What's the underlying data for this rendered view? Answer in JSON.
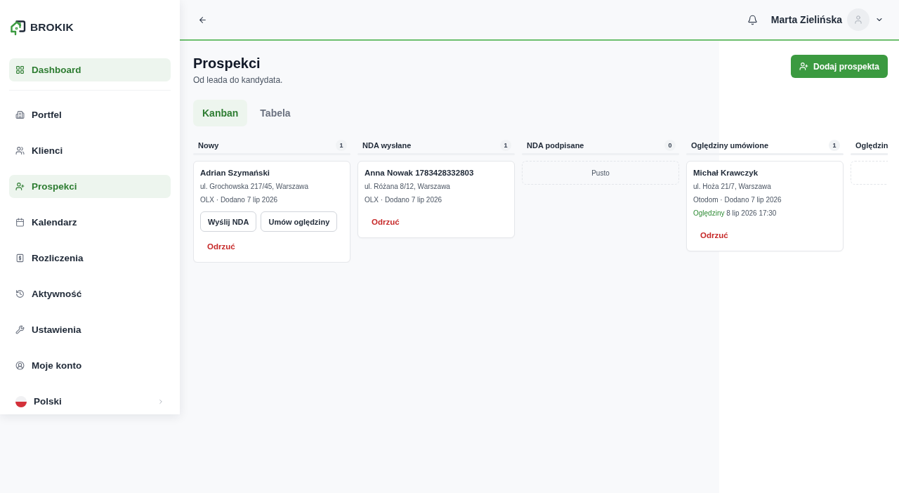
{
  "sidebar": {
    "logo": "BROKIK",
    "top_items": [
      {
        "label": "Dashboard",
        "selected": true
      }
    ],
    "items": [
      {
        "label": "Portfel",
        "selected": false
      },
      {
        "label": "Klienci",
        "selected": false
      },
      {
        "label": "Prospekci",
        "selected": true
      },
      {
        "label": "Kalendarz",
        "selected": false
      },
      {
        "label": "Rozliczenia",
        "selected": false
      },
      {
        "label": "Aktywność",
        "selected": false
      },
      {
        "label": "Ustawienia",
        "selected": false
      },
      {
        "label": "Moje konto",
        "selected": false
      }
    ],
    "language": {
      "label": "Polski"
    }
  },
  "header": {
    "user_name": "Marta Zielińska"
  },
  "page": {
    "title": "Prospekci",
    "subtitle": "Od leada do kandydata.",
    "primary_button": "Dodaj prospekta"
  },
  "tabs": [
    {
      "label": "Kanban",
      "selected": true
    },
    {
      "label": "Tabela",
      "selected": false
    }
  ],
  "columns": [
    {
      "title": "Nowy",
      "count": "1",
      "cards": [
        {
          "name": "Adrian Szymański",
          "address": "ul. Grochowska 217/45, Warszawa",
          "meta": "OLX · Dodano 7 lip 2026",
          "actions": [
            {
              "label": "Wyślij NDA",
              "kind": "outline"
            },
            {
              "label": "Umów oględziny",
              "kind": "outline"
            },
            {
              "label": "Odrzuć",
              "kind": "danger"
            }
          ]
        }
      ]
    },
    {
      "title": "NDA wysłane",
      "count": "1",
      "cards": [
        {
          "name": "Anna Nowak 1783428332803",
          "address": "ul. Różana 8/12, Warszawa",
          "meta": "OLX · Dodano 7 lip 2026",
          "actions": [
            {
              "label": "Odrzuć",
              "kind": "danger"
            }
          ]
        }
      ]
    },
    {
      "title": "NDA podpisane",
      "count": "0",
      "empty_label": "Pusto"
    },
    {
      "title": "Oględziny umówione",
      "count": "1",
      "cards": [
        {
          "name": "Michał Krawczyk",
          "address": "ul. Hoża 21/7, Warszawa",
          "meta": "Otodom · Dodano 7 lip 2026",
          "viewing": {
            "label": "Oględziny",
            "value": "8 lip 2026 17:30"
          },
          "actions": [
            {
              "label": "Odrzuć",
              "kind": "danger"
            }
          ]
        }
      ]
    },
    {
      "title": "Oględzin"
    }
  ]
}
